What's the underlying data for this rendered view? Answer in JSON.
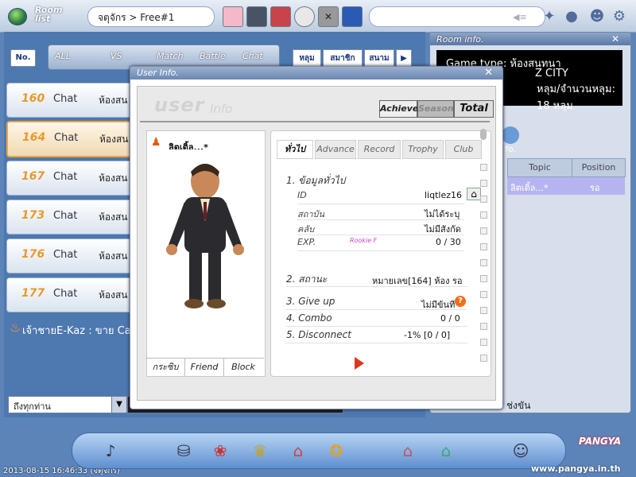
{
  "topbar": {
    "logo_text": "Room\nlist",
    "breadcrumb": "จตุจักร > Free#1"
  },
  "tabs": {
    "no_label": "No.",
    "filters": [
      "ALL",
      "VS",
      "Match",
      "Battle",
      "Chat"
    ],
    "sort_buttons": [
      "หลุม",
      "สมาชิก",
      "สนาม"
    ]
  },
  "rooms": [
    {
      "num": "160",
      "type": "Chat",
      "name": "ห้องสน"
    },
    {
      "num": "164",
      "type": "Chat",
      "name": "ห้องสน"
    },
    {
      "num": "167",
      "type": "Chat",
      "name": "ห้องสน"
    },
    {
      "num": "173",
      "type": "Chat",
      "name": "ห้องสน"
    },
    {
      "num": "176",
      "type": "Chat",
      "name": "ห้องสน"
    },
    {
      "num": "177",
      "type": "Chat",
      "name": "ห้องสน"
    }
  ],
  "chat": {
    "line": "เจ้าชายE-Kaz : ขาย Ca",
    "channel_select": "ถึงทุกท่าน"
  },
  "datetime": "2013-08-15 16:46:33 (จตุจักร)",
  "room_info": {
    "title": "Room info.",
    "lines": [
      "Game type: ห้องสนทนา",
      "Z CITY",
      "หลุม/จำนวนหลุม: 18 หลุม"
    ],
    "info_label": "fo.",
    "columns": [
      "Topic",
      "Position"
    ],
    "row": {
      "name": "ลิตเติ้ล...*",
      "position": "รอ"
    },
    "footer_text": "ช่งขัน"
  },
  "user_info": {
    "title": "User Info.",
    "header_big": "user",
    "header_small": "Info",
    "top_tabs": [
      "Achieve.",
      "Season",
      "Total"
    ],
    "char_name": "ลิตเติ้ล...*",
    "actions": [
      "กระซิบ",
      "Friend",
      "Block"
    ],
    "detail_tabs": [
      "ทั่วไป",
      "Advance",
      "Record",
      "Trophy",
      "Club"
    ],
    "section1_title": "1. ข้อมูลทั่วไป",
    "fields": [
      {
        "label": "ID",
        "value": "liqtlez16"
      },
      {
        "label": "สถาบัน",
        "value": "ไม่ได้ระบุ"
      },
      {
        "label": "คลับ",
        "value": "ไม่มีสังกัด"
      },
      {
        "label": "EXP.",
        "value": "0 / 30"
      }
    ],
    "exp_rank": "Rookie F",
    "status": {
      "label": "2. สถานะ",
      "value": "หมายเลข[164] ห้อง รอ"
    },
    "stats": [
      {
        "label": "3. Give up",
        "value": "ไม่มีข้นที"
      },
      {
        "label": "4. Combo",
        "value": "0 / 0"
      },
      {
        "label": "5. Disconnect",
        "value": "-1% [0 / 0]"
      }
    ]
  },
  "branding": {
    "logo": "PANGYA",
    "url": "www.pangya.in.th"
  }
}
